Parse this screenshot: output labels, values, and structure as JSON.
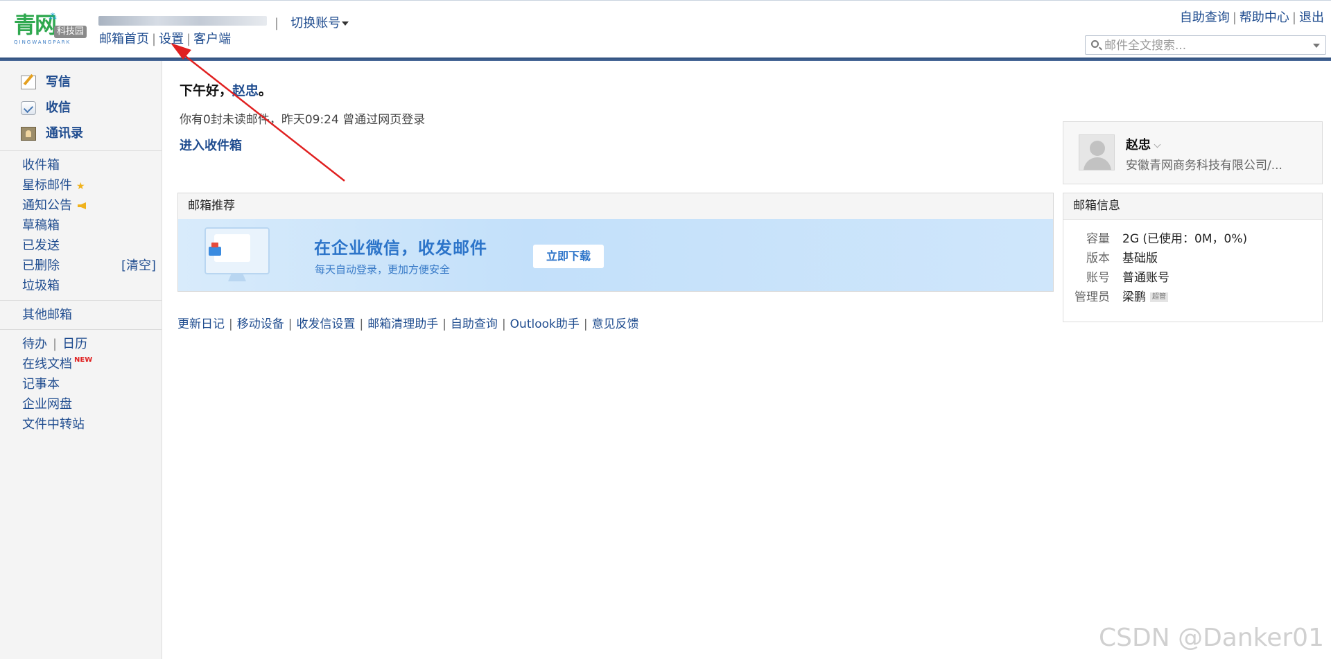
{
  "header": {
    "logo_text": "青网",
    "logo_badge": "科技园",
    "logo_sub": "QINGWANGPARK",
    "switch_account": "切换账号",
    "sep": "|",
    "nav": [
      "邮箱首页",
      "设置",
      "客户端"
    ],
    "top_links": [
      "自助查询",
      "帮助中心",
      "退出"
    ],
    "search_placeholder": "邮件全文搜索..."
  },
  "sidebar": {
    "actions": [
      "写信",
      "收信",
      "通讯录"
    ],
    "folders": [
      "收件箱",
      "星标邮件",
      "通知公告",
      "草稿箱",
      "已发送",
      "已删除",
      "垃圾箱"
    ],
    "clear_label": "[清空]",
    "other_mailbox": "其他邮箱",
    "tools": {
      "todo": "待办",
      "calendar": "日历",
      "docs": "在线文档",
      "docs_badge": "NEW",
      "notes": "记事本",
      "disk": "企业网盘",
      "transfer": "文件中转站"
    }
  },
  "main": {
    "greeting_prefix": "下午好，",
    "user_name": "赵忠",
    "greeting_suffix": "。",
    "unread_text": "你有0封未读邮件，昨天09:24 曾通过网页登录",
    "enter_inbox": "进入收件箱",
    "recommend": {
      "title": "邮箱推荐",
      "banner_title": "在企业微信，收发邮件",
      "banner_sub": "每天自动登录，更加方便安全",
      "download": "立即下载"
    },
    "footer_links": [
      "更新日记",
      "移动设备",
      "收发信设置",
      "邮箱清理助手",
      "自助查询",
      "Outlook助手",
      "意见反馈"
    ]
  },
  "profile": {
    "name": "赵忠",
    "org": "安徽青网商务科技有限公司/..."
  },
  "mailbox_info": {
    "title": "邮箱信息",
    "rows": [
      {
        "key": "容量",
        "value": "2G (已使用：0M，0%)"
      },
      {
        "key": "版本",
        "value": "基础版"
      },
      {
        "key": "账号",
        "value": "普通账号"
      },
      {
        "key": "管理员",
        "value": "梁鹏"
      }
    ],
    "admin_badge": "超管"
  },
  "watermark": "CSDN @Danker01",
  "colors": {
    "link": "#1f4c8f",
    "header_bar": "#2c4c7a",
    "annotation": "#e02020"
  }
}
